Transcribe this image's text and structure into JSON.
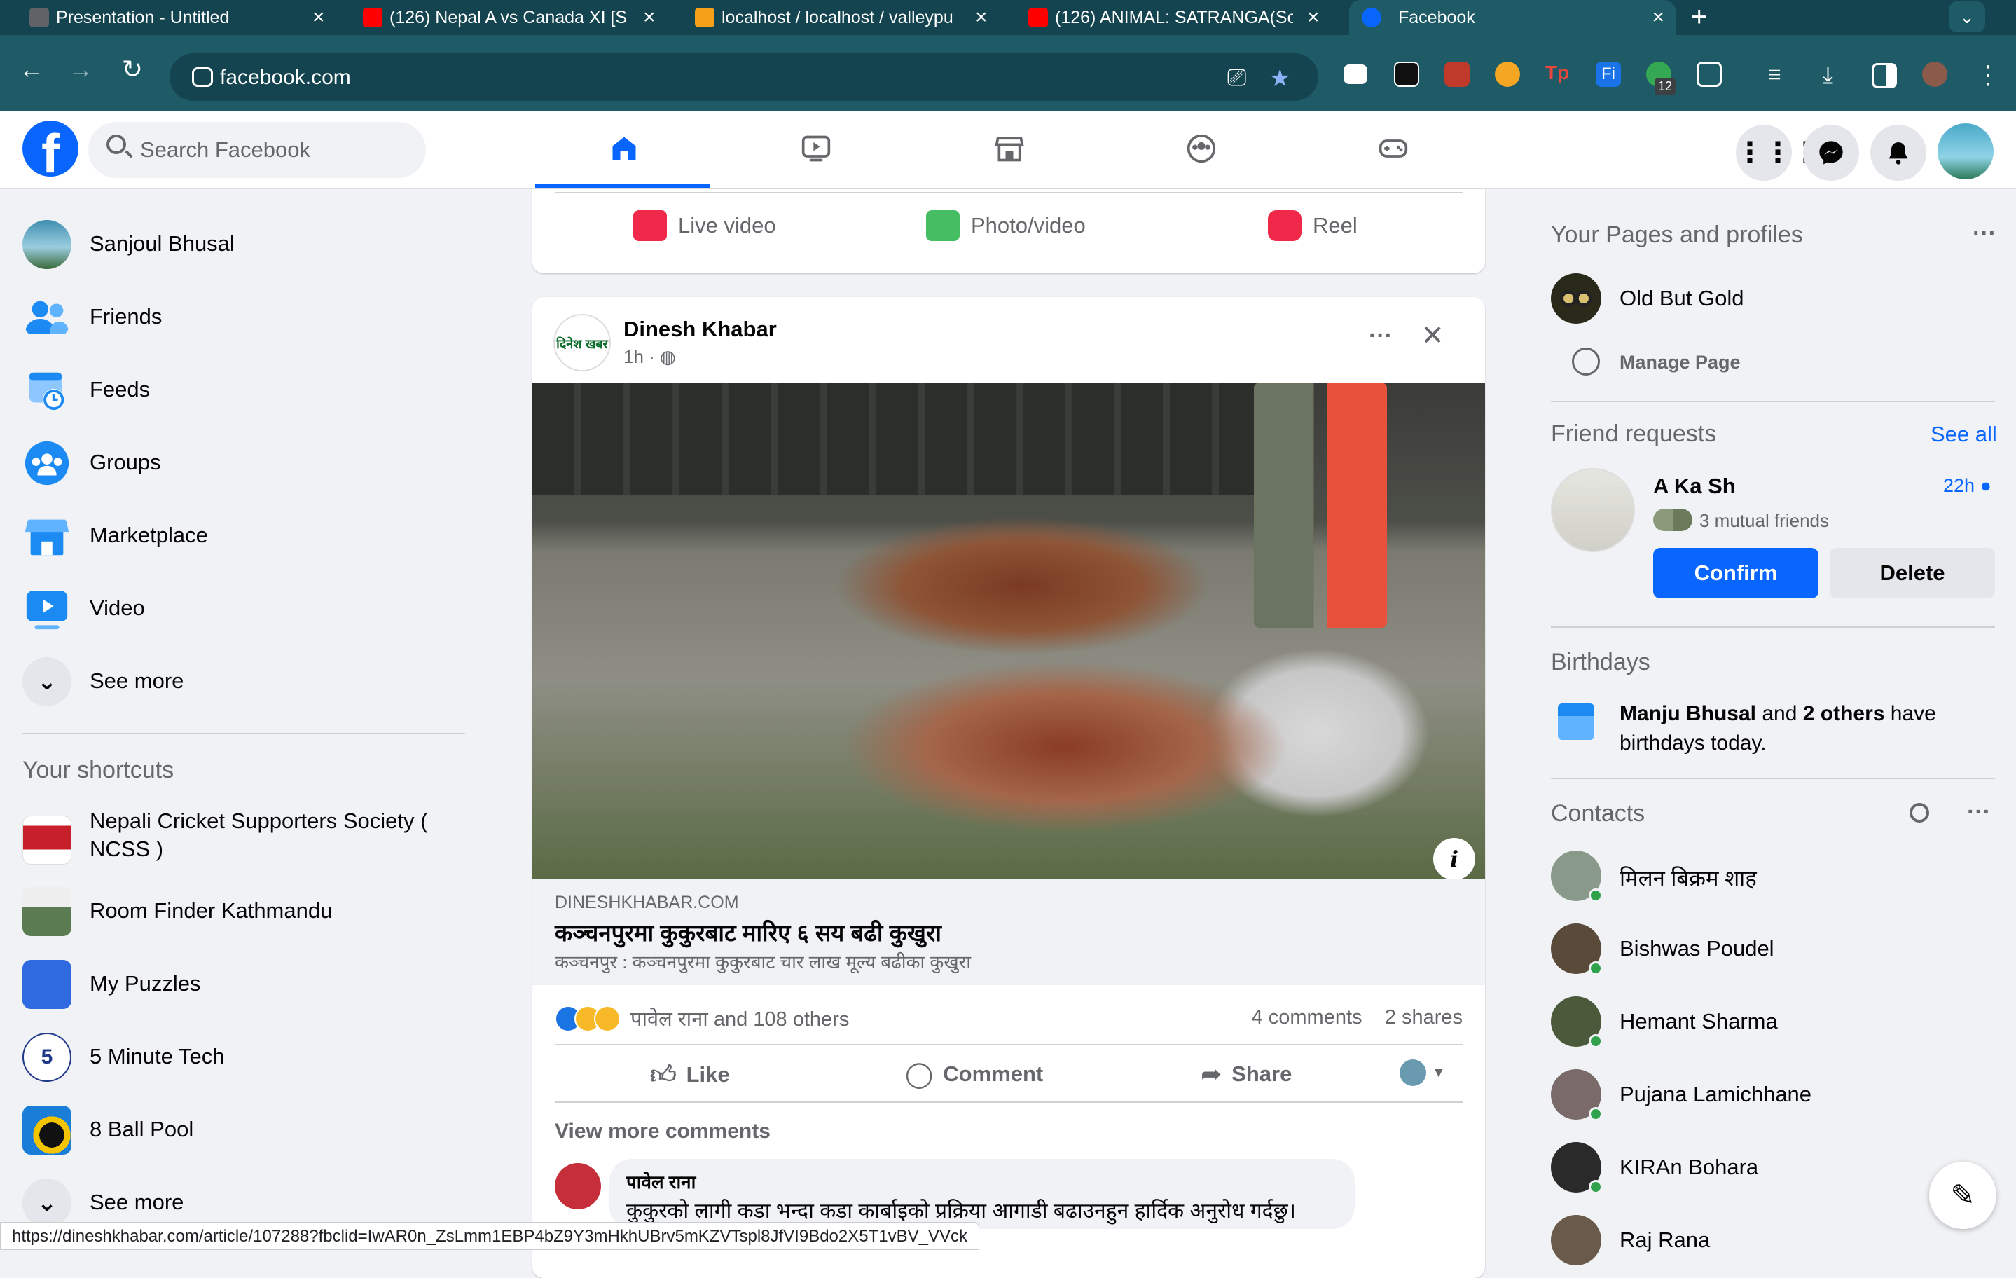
{
  "browser": {
    "tabs": [
      {
        "title": "Presentation - Untitled",
        "fav_color": "#5f6368"
      },
      {
        "title": "(126) Nepal A vs Canada XI [S",
        "fav_color": "#ff0000"
      },
      {
        "title": "localhost / localhost / valleypu",
        "fav_color": "#f6a01a"
      },
      {
        "title": "(126) ANIMAL: SATRANGA(So",
        "fav_color": "#ff0000"
      },
      {
        "title": "Facebook",
        "fav_color": "#0866ff"
      }
    ],
    "new_tab": "+",
    "url": "facebook.com",
    "status_url": "https://dineshkhabar.com/article/107288?fbclid=IwAR0n_ZsLmm1EBP4bZ9Y3mHkhUBrv5mKZVTspl8JfVI9Bdo2X5T1vBV_VVck",
    "extension_badge": "12"
  },
  "header": {
    "search_placeholder": "Search Facebook",
    "nav": [
      "home",
      "video",
      "marketplace",
      "groups",
      "gaming"
    ],
    "active_nav": "home"
  },
  "left": {
    "items": [
      {
        "label": "Sanjoul Bhusal",
        "icon": "profile-avatar",
        "color": "#6a9ab0"
      },
      {
        "label": "Friends",
        "icon": "friends-icon",
        "color": "#1b8af2"
      },
      {
        "label": "Feeds",
        "icon": "feeds-icon",
        "color": "#1b8af2"
      },
      {
        "label": "Groups",
        "icon": "groups-icon",
        "color": "#1b8af2"
      },
      {
        "label": "Marketplace",
        "icon": "marketplace-icon",
        "color": "#1b8af2"
      },
      {
        "label": "Video",
        "icon": "video-icon",
        "color": "#1b8af2"
      },
      {
        "label": "See more",
        "icon": "chevron-down-icon",
        "color": "#e4e6eb"
      }
    ],
    "shortcuts_title": "Your shortcuts",
    "shortcuts": [
      {
        "label": "Nepali Cricket Supporters Society (",
        "label2": "NCSS )",
        "color": "#c8202a"
      },
      {
        "label": "Room Finder Kathmandu",
        "color": "#5b7b52"
      },
      {
        "label": "My Puzzles",
        "color": "#2f6ae0"
      },
      {
        "label": "5 Minute Tech",
        "color": "#203a8a"
      },
      {
        "label": "8 Ball Pool",
        "color": "#1a7ed8"
      },
      {
        "label": "See more",
        "color": "#e4e6eb"
      }
    ]
  },
  "composer": {
    "actions": [
      {
        "label": "Live video",
        "color": "#f02849"
      },
      {
        "label": "Photo/video",
        "color": "#45bd62"
      },
      {
        "label": "Reel",
        "color": "#f02849"
      }
    ]
  },
  "post": {
    "author": "Dinesh Khabar",
    "avatar_text": "दिनेश खबर",
    "time": "1h ·",
    "link_domain": "DINESHKHABAR.COM",
    "link_title": "कञ्चनपुरमा कुकुरबाट मारिए ६ सय बढी कुखुरा",
    "link_desc": "कञ्चनपुर : कञ्चनपुरमा कुकुरबाट चार लाख मूल्य बढीका कुखुरा",
    "reactions_text": "पावेल राना and 108 others",
    "comments": "4 comments",
    "shares": "2 shares",
    "like": "Like",
    "comment": "Comment",
    "share": "Share",
    "view_more": "View more comments",
    "comment_author": "पावेल राना",
    "comment_text": "कुकुरको लागी कडा भन्दा कडा कार्बाइको प्रक्रिया आगाडी बढाउनहुन हार्दिक अनुरोध गर्दछु। धन्यवाद"
  },
  "right": {
    "pages_title": "Your Pages and profiles",
    "page_name": "Old But Gold",
    "manage_page": "Manage Page",
    "friend_requests_title": "Friend requests",
    "see_all": "See all",
    "request_name": "A Ka Sh",
    "request_time": "22h",
    "mutual": "3 mutual friends",
    "confirm": "Confirm",
    "delete": "Delete",
    "birthdays_title": "Birthdays",
    "birthday_name": "Manju Bhusal",
    "birthday_and": " and ",
    "birthday_others": "2 others",
    "birthday_rest1": " have",
    "birthday_rest2": "birthdays today.",
    "contacts_title": "Contacts",
    "contacts": [
      {
        "name": "मिलन बिक्रम शाह",
        "color": "#8a9a8a"
      },
      {
        "name": "Bishwas Poudel",
        "color": "#5a4a3a"
      },
      {
        "name": "Hemant Sharma",
        "color": "#4a5a3a"
      },
      {
        "name": "Pujana Lamichhane",
        "color": "#7a6a6a"
      },
      {
        "name": "KIRAn Bohara",
        "color": "#2a2a2a"
      },
      {
        "name": "Raj Rana",
        "color": "#6a5a4a"
      }
    ]
  }
}
